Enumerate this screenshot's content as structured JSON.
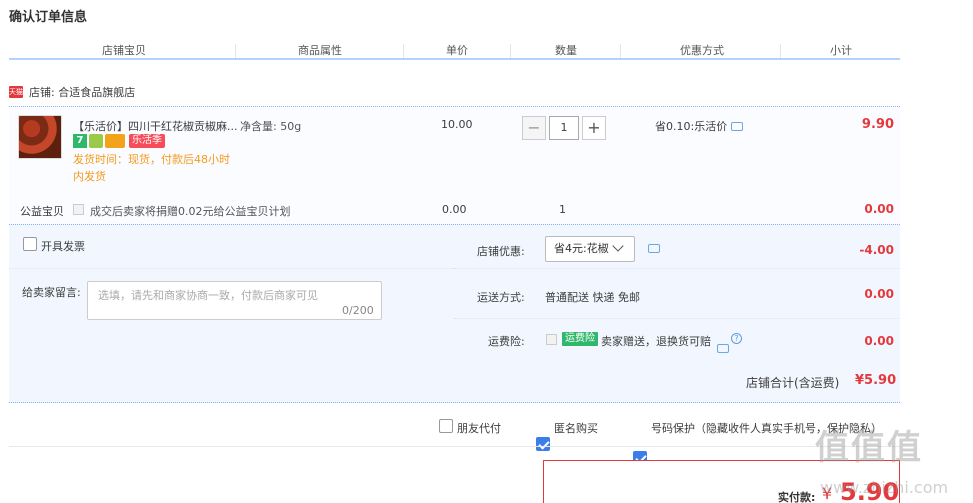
{
  "page_title": "确认订单信息",
  "columns": [
    "店铺宝贝",
    "商品属性",
    "单价",
    "数量",
    "优惠方式",
    "小计"
  ],
  "shop": {
    "badge": "天猫",
    "label": "店铺: 合适食品旗舰店"
  },
  "item": {
    "name": "【乐活价】四川干红花椒贡椒麻...",
    "property": "净含量: 50g",
    "badge_seven": "7",
    "event_badge": "乐活季",
    "ship_note": "发货时间：现货，付款后48小时内发货",
    "unit_price": "10.00",
    "quantity": "1",
    "qty_minus": "−",
    "qty_plus": "+",
    "promotion": "省0.10:乐活价",
    "subtotal": "9.90"
  },
  "charity": {
    "label": "公益宝贝",
    "text": "成交后卖家将捐赠0.02元给公益宝贝计划",
    "price": "0.00",
    "quantity": "1",
    "total": "0.00"
  },
  "invoice": {
    "label": "开具发票",
    "checked": false
  },
  "memo": {
    "label": "给卖家留言:",
    "placeholder": "选填，请先和商家协商一致，付款后商家可见",
    "count": "0/200"
  },
  "shop_discount": {
    "label": "店铺优惠:",
    "selected": "省4元:花椒",
    "value": "-4.00"
  },
  "shipping": {
    "label": "运送方式:",
    "text": "普通配送 快递 免邮",
    "value": "0.00"
  },
  "insurance": {
    "label": "运费险:",
    "badge": "运费险",
    "text": "卖家赠送，退换货可赔",
    "help": "?",
    "value": "0.00"
  },
  "shop_total": {
    "label": "店铺合计(含运费)",
    "value": "¥5.90"
  },
  "options": [
    {
      "label": "朋友代付",
      "checked": false
    },
    {
      "label": "匿名购买",
      "checked": true
    },
    {
      "label": "号码保护（隐藏收件人真实手机号，保护隐私）",
      "checked": true
    }
  ],
  "payment": {
    "label": "实付款:",
    "currency": "¥",
    "value": "5.90"
  },
  "watermark": {
    "logo": "值值值",
    "url": "www.zhizhi.com"
  }
}
